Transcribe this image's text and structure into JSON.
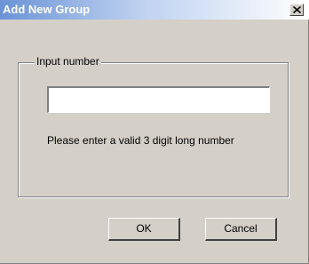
{
  "window": {
    "title": "Add New Group",
    "close_icon": "close-icon"
  },
  "group": {
    "legend": "Input number",
    "input_value": "",
    "hint": "Please enter a valid 3 digit long number"
  },
  "buttons": {
    "ok": "OK",
    "cancel": "Cancel"
  },
  "colors": {
    "dialog_background": "#d4d0c8",
    "titlebar_start": "#6b93d6",
    "titlebar_end": "#ffffff",
    "title_text": "#ffffff"
  }
}
